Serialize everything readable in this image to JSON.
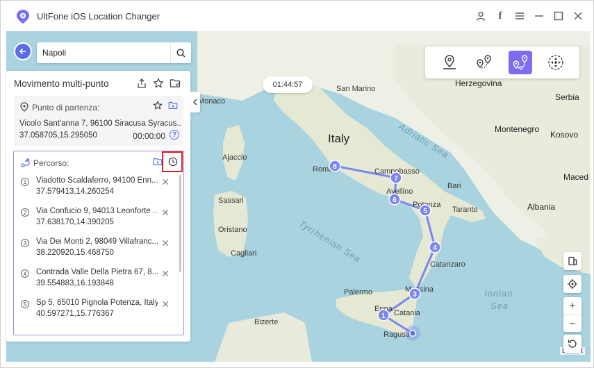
{
  "app": {
    "title": "UltFone iOS Location Changer"
  },
  "search": {
    "value": "Napoli"
  },
  "panel": {
    "title": "Movimento multi-punto",
    "start": {
      "label": "Punto di partenza:",
      "address": "Vicolo Sant'anna 7, 96100 Siracusa Syracus...",
      "coords": "37.058705,15.295050",
      "time": "00:00:00",
      "help": "?"
    },
    "route": {
      "label": "Percorso:",
      "items": [
        {
          "num": "1",
          "address": "Viadotto Scaldaferro, 94100 Enn...",
          "coords": "37.579413,14.260254"
        },
        {
          "num": "2",
          "address": "Via Confucio 9, 94013 Leonforte ...",
          "coords": "37.638170,14.390205"
        },
        {
          "num": "3",
          "address": "Via Dei Monti 2, 98049 Villafranc...",
          "coords": "38.220920,15.468750"
        },
        {
          "num": "4",
          "address": "Contrada Valle Della Pietra 67, 8...",
          "coords": "39.554883,16.193848"
        },
        {
          "num": "5",
          "address": "Sp 5, 85010 Pignola Potenza, Italy",
          "coords": "40.597271,15.776367"
        }
      ]
    }
  },
  "timer": "01:44:57",
  "map": {
    "labels": {
      "monaco": "Monaco",
      "san_marino": "San Marino",
      "herzegovina": "Herzegovina",
      "serbia": "Serbia",
      "montenegro": "Montenegro",
      "kosovo": "Kosovo",
      "maced": "Maced",
      "albania": "Albania",
      "italy": "Italy",
      "ajaccio": "Ajaccio",
      "sassari": "Sassari",
      "oristano": "Oristano",
      "cagliari": "Cagliari",
      "roma": "Roma",
      "campobasso": "Campobasso",
      "bari": "Bari",
      "avellino": "Avellino",
      "potenza": "Potenza",
      "taranto": "Taranto",
      "catanzaro": "Catanzaro",
      "palermo": "Palermo",
      "messina": "Messina",
      "catania": "Catania",
      "ragusa": "Ragusa",
      "enna": "Enna",
      "bizerte": "Bizerte",
      "adriatic": "Adriatic Sea",
      "tyrrhenian": "Tyrrhenian Sea",
      "ionian": "Ionian",
      "sea": "Sea"
    },
    "markers": [
      "1",
      "3",
      "4",
      "5",
      "6",
      "7",
      "8"
    ],
    "attribution": "Leaflet"
  },
  "colors": {
    "accent": "#7c6cf0",
    "route": "#7b86ef",
    "highlight": "#e02020"
  }
}
